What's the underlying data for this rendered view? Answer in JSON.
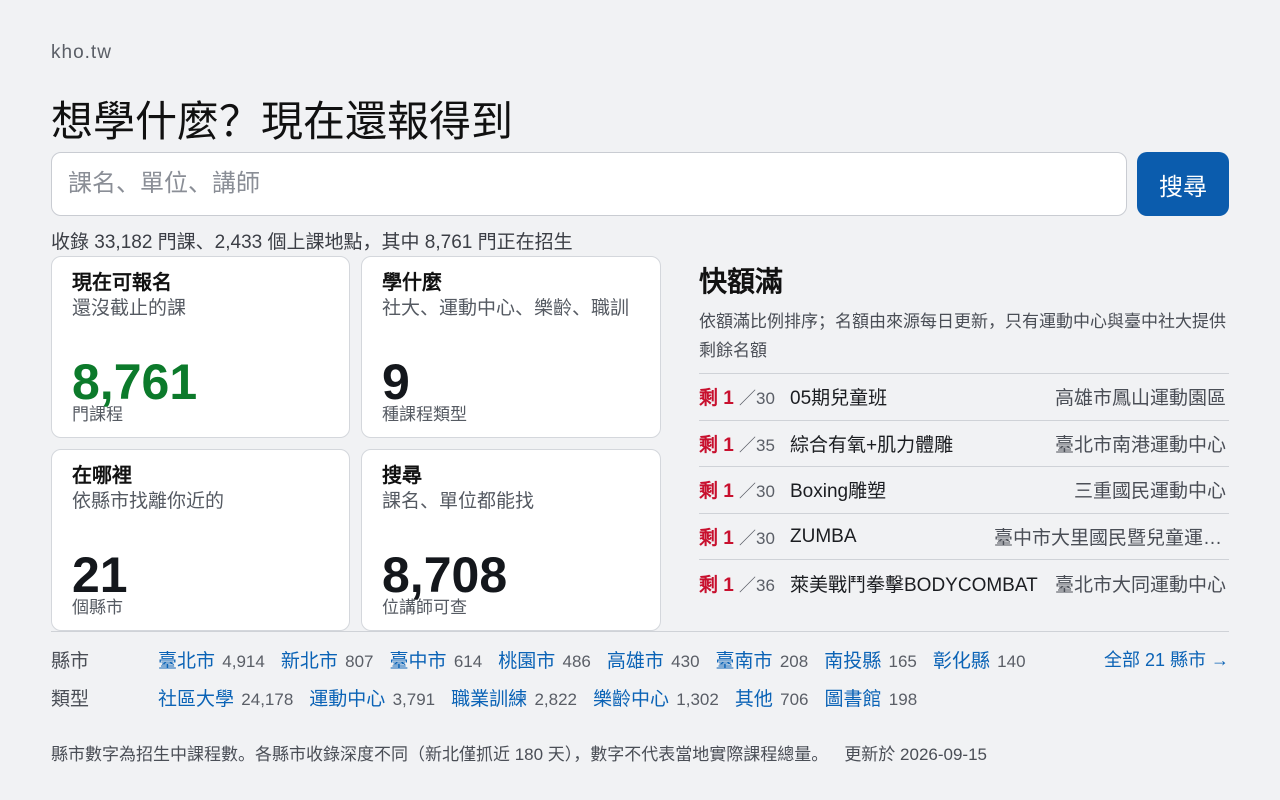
{
  "site": "kho.tw",
  "hero": "想學什麼？現在還報得到",
  "search": {
    "placeholder": "課名、單位、講師",
    "button": "搜尋"
  },
  "stats": "收錄 33,182 門課、2,433 個上課地點，其中 8,761 門正在招生",
  "cards": [
    {
      "title": "現在可報名",
      "subtitle": "還沒截止的課",
      "number": "8,761",
      "unit": "門課程"
    },
    {
      "title": "學什麼",
      "subtitle": "社大、運動中心、樂齡、職訓",
      "number": "9",
      "unit": "種課程類型"
    },
    {
      "title": "在哪裡",
      "subtitle": "依縣市找離你近的",
      "number": "21",
      "unit": "個縣市"
    },
    {
      "title": "搜尋",
      "subtitle": "課名、單位都能找",
      "number": "8,708",
      "unit": "位講師可查"
    }
  ],
  "quickfull": {
    "title": "快額滿",
    "desc": "依額滿比例排序；名額由來源每日更新，只有運動中心與臺中社大提供剩餘名額",
    "items": [
      {
        "remain": "剩 1",
        "total": "／30",
        "name": "05期兒童班",
        "place": "高雄市鳳山運動園區"
      },
      {
        "remain": "剩 1",
        "total": "／35",
        "name": "綜合有氧+肌力體雕",
        "place": "臺北市南港運動中心"
      },
      {
        "remain": "剩 1",
        "total": "／30",
        "name": "Boxing雕塑",
        "place": "三重國民運動中心"
      },
      {
        "remain": "剩 1",
        "total": "／30",
        "name": "ZUMBA",
        "place": "臺中市大里國民暨兒童運動…"
      },
      {
        "remain": "剩 1",
        "total": "／36",
        "name": "萊美戰鬥拳擊BODYCOMBAT",
        "place": "臺北市大同運動中心"
      }
    ]
  },
  "counties": {
    "label": "縣市",
    "items": [
      {
        "name": "臺北市",
        "count": "4,914"
      },
      {
        "name": "新北市",
        "count": "807"
      },
      {
        "name": "臺中市",
        "count": "614"
      },
      {
        "name": "桃園市",
        "count": "486"
      },
      {
        "name": "高雄市",
        "count": "430"
      },
      {
        "name": "臺南市",
        "count": "208"
      },
      {
        "name": "南投縣",
        "count": "165"
      },
      {
        "name": "彰化縣",
        "count": "140"
      }
    ],
    "all": "全部 21 縣市 →"
  },
  "types": {
    "label": "類型",
    "items": [
      {
        "name": "社區大學",
        "count": "24,178"
      },
      {
        "name": "運動中心",
        "count": "3,791"
      },
      {
        "name": "職業訓練",
        "count": "2,822"
      },
      {
        "name": "樂齡中心",
        "count": "1,302"
      },
      {
        "name": "其他",
        "count": "706"
      },
      {
        "name": "圖書館",
        "count": "198"
      }
    ]
  },
  "footer": {
    "note": "縣市數字為招生中課程數。各縣市收錄深度不同（新北僅抓近 180 天），數字不代表當地實際課程總量。",
    "updated": "更新於 2026-09-15"
  }
}
